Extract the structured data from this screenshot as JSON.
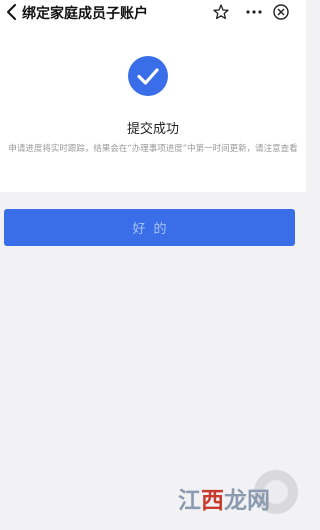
{
  "header": {
    "title": "绑定家庭成员子账户",
    "icons": [
      "back-icon",
      "star-icon",
      "more-icon",
      "close-icon"
    ]
  },
  "result": {
    "title": "提交成功",
    "description": "申请进度将实时跟踪，结果会在“办理事项进度”中第一时间更新，请注意查看",
    "icon": "check-circle-icon"
  },
  "actions": {
    "ok_label": "好的"
  },
  "watermark": {
    "part1": "江",
    "part2": "西",
    "part3": "龙网"
  },
  "colors": {
    "accent": "#3a6ee8",
    "button_text": "#a9c2f5",
    "background": "#f2f2f5"
  }
}
